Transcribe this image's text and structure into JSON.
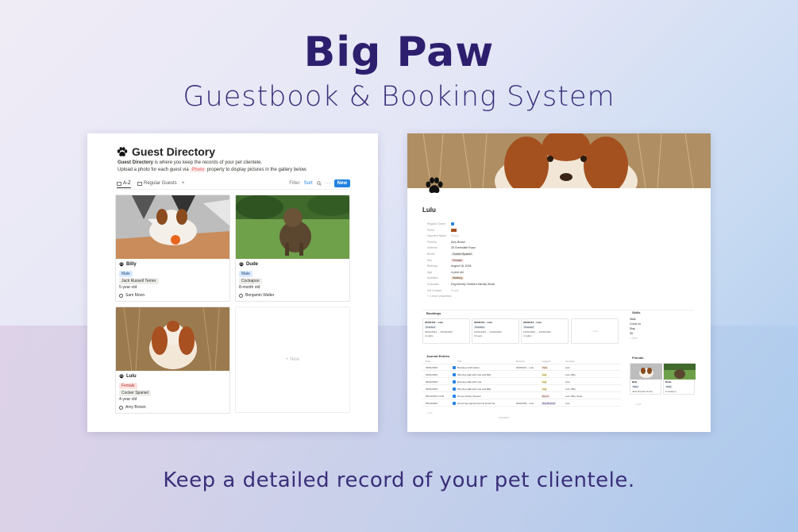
{
  "header": {
    "title": "Big Paw",
    "subtitle": "Guestbook & Booking System"
  },
  "tagline": "Keep a detailed record of your pet clientele.",
  "colors": {
    "title": "#2d1f6e",
    "accent_blue": "#2383e2",
    "male_badge": "#dbeafe",
    "female_badge": "#fde2e1"
  },
  "directory": {
    "title": "Guest Directory",
    "desc_bold": "Guest Directory",
    "desc_rest": " is where you keep the records of your pet clientele.",
    "desc_line2_a": "Upload a photo for each guest via ",
    "desc_photo": "Photo",
    "desc_line2_b": " property to display pictures in the gallery below.",
    "tabs": [
      "A-Z",
      "Regular Guests"
    ],
    "add_tab": "+",
    "actions": {
      "filter": "Filter",
      "sort": "Sort",
      "more": "···",
      "new": "New"
    },
    "cards": [
      {
        "name": "Billy",
        "gender": "Male",
        "breed": "Jack Russell Terrier",
        "age": "5-year old",
        "owner": "Sam Moon"
      },
      {
        "name": "Dude",
        "gender": "Male",
        "breed": "Cockapoo",
        "age": "8-month old",
        "owner": "Benjamin Walter"
      },
      {
        "name": "Lulu",
        "gender": "Female",
        "breed": "Cocker Spaniel",
        "age": "4-year old",
        "owner": "Amy Brown"
      }
    ],
    "new_card": "+ New"
  },
  "detail": {
    "title": "Lulu",
    "properties": [
      {
        "key": "Regular Guest",
        "value": ""
      },
      {
        "key": "Photo",
        "value": ""
      },
      {
        "key": "Imported Name",
        "value": "Empty"
      },
      {
        "key": "Parents",
        "value": "Amy Brown"
      },
      {
        "key": "Address",
        "value": "25 Greendale Road"
      },
      {
        "key": "Breed",
        "value": "Cocker Spaniel"
      },
      {
        "key": "Sex",
        "value": "Female"
      },
      {
        "key": "Birthday",
        "value": "August 18, 2018"
      },
      {
        "key": "Age",
        "value": "4-year old"
      },
      {
        "key": "Activities",
        "value": "Walking"
      },
      {
        "key": "Character",
        "value": "Dog friendly  Children friendly  Smart"
      },
      {
        "key": "Vet Contact",
        "value": "Empty"
      }
    ],
    "more_props": "+ 3 more properties",
    "bookings_title": "Bookings",
    "bookings": [
      {
        "title": "20230104 – Lulu",
        "status": "Checked",
        "dates": "03/01/2023 → 05/01/2023",
        "nights": "4 nights"
      },
      {
        "title": "20230101 – Lulu",
        "status": "Checked",
        "dates": "12/01/2023 → 12/01/2023",
        "nights": "3 hours"
      },
      {
        "title": "20230113 – Lulu",
        "status": "Checked",
        "dates": "13/01/2023 → 15/01/2023",
        "nights": "4 nights"
      }
    ],
    "bookings_new": "+ New",
    "skills_title": "Skills",
    "skills": [
      "Walk",
      "Come on",
      "Stay",
      "Sit"
    ],
    "skills_new": "+ New",
    "friends_title": "Friends",
    "friends": [
      {
        "name": "Billy",
        "gender": "Male",
        "breed": "Jack Russell Terrier"
      },
      {
        "name": "Dude",
        "gender": "Male",
        "breed": "Cockapoo"
      }
    ],
    "friends_new": "+ New",
    "journal_title": "Journal Entries",
    "journal_cols": [
      "Date",
      "Title",
      "Booking",
      "Category",
      "Guest(s)"
    ],
    "journal": [
      {
        "date": "03/01/2023",
        "title": "Booking confirmation",
        "booking": "20230113 – Lulu",
        "category": "Task",
        "guests": "Lulu"
      },
      {
        "date": "03/01/2023",
        "title": "Morning walk with Lulu and Billy",
        "booking": "",
        "category": "Log",
        "guests": "Lulu, Billy"
      },
      {
        "date": "03/01/2023",
        "title": "Evening walk with Lulu",
        "booking": "",
        "category": "Log",
        "guests": "Lulu"
      },
      {
        "date": "04/01/2023",
        "title": "Morning walk with Lulu and Billy",
        "booking": "",
        "category": "Log",
        "guests": "Lulu, Billy"
      },
      {
        "date": "05/12/2022 11:00",
        "title": "Group Activity Session",
        "booking": "",
        "category": "Event",
        "guests": "Lulu, Billy, Dude"
      },
      {
        "date": "05/12/2022",
        "title": "Grooming Appointment at Good Vet",
        "booking": "20221202 – Lulu",
        "category": "Day Record",
        "guests": "Lulu"
      }
    ],
    "journal_new": "+ New",
    "journal_count": "COUNT 6"
  }
}
